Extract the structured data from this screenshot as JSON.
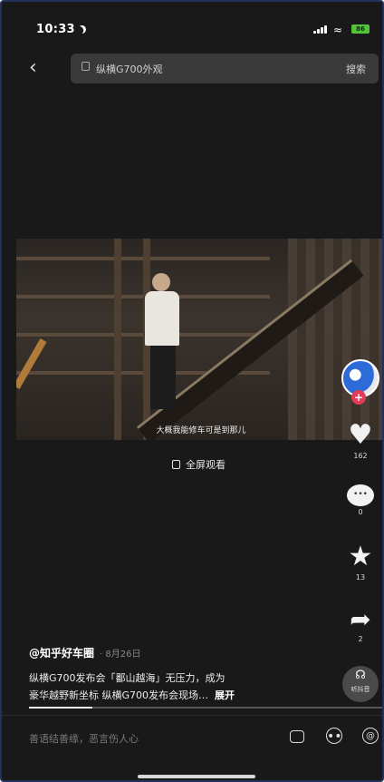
{
  "status_bar": {
    "time": "10:33",
    "battery": "86"
  },
  "search": {
    "query": "纵横G700外观",
    "button_label": "搜索"
  },
  "video": {
    "subtitle": "大概我能修车可是到那儿",
    "fullscreen_label": "全屏观看",
    "progress": 0.18
  },
  "actions": {
    "like_count": "162",
    "comment_count": "0",
    "favorite_count": "13",
    "share_count": "2",
    "listen_label": "听抖音"
  },
  "post": {
    "author": "@知乎好车圈",
    "date": "· 8月26日",
    "description": "纵横G700发布会「鄱山越海」无压力，成为",
    "description_line2": "豪华越野新坐标 纵横G700发布会现场…",
    "more_label": "展开"
  },
  "comment_bar": {
    "placeholder": "善语结善缘，恶言伤人心"
  },
  "colors": {
    "background": "#191919",
    "like_plus": "#e33a55",
    "battery": "#52c23b"
  },
  "icons": [
    "back-icon",
    "search-icon",
    "signal-icon",
    "wifi-icon",
    "battery-icon",
    "fullscreen-icon",
    "plus-icon",
    "heart-icon",
    "comment-icon",
    "star-icon",
    "share-icon",
    "headphones-icon",
    "image-icon",
    "emoji-icon",
    "at-icon"
  ]
}
